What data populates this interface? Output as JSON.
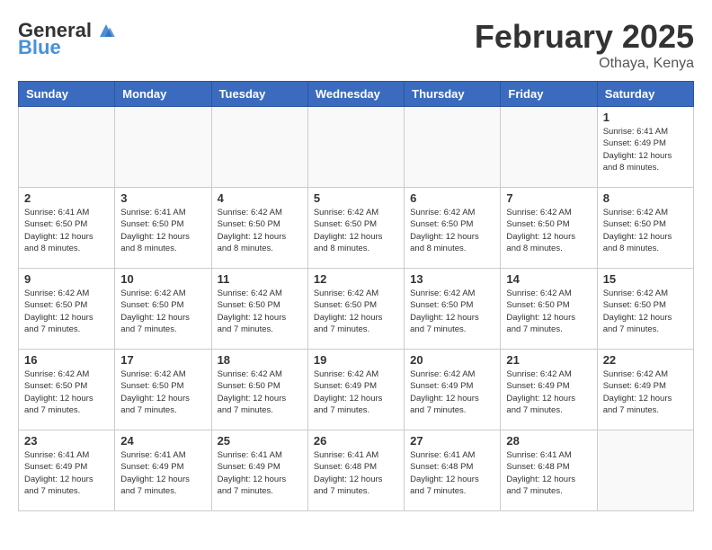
{
  "logo": {
    "general": "General",
    "blue": "Blue"
  },
  "header": {
    "month": "February 2025",
    "location": "Othaya, Kenya"
  },
  "weekdays": [
    "Sunday",
    "Monday",
    "Tuesday",
    "Wednesday",
    "Thursday",
    "Friday",
    "Saturday"
  ],
  "weeks": [
    [
      {
        "day": "",
        "info": ""
      },
      {
        "day": "",
        "info": ""
      },
      {
        "day": "",
        "info": ""
      },
      {
        "day": "",
        "info": ""
      },
      {
        "day": "",
        "info": ""
      },
      {
        "day": "",
        "info": ""
      },
      {
        "day": "1",
        "info": "Sunrise: 6:41 AM\nSunset: 6:49 PM\nDaylight: 12 hours\nand 8 minutes."
      }
    ],
    [
      {
        "day": "2",
        "info": "Sunrise: 6:41 AM\nSunset: 6:50 PM\nDaylight: 12 hours\nand 8 minutes."
      },
      {
        "day": "3",
        "info": "Sunrise: 6:41 AM\nSunset: 6:50 PM\nDaylight: 12 hours\nand 8 minutes."
      },
      {
        "day": "4",
        "info": "Sunrise: 6:42 AM\nSunset: 6:50 PM\nDaylight: 12 hours\nand 8 minutes."
      },
      {
        "day": "5",
        "info": "Sunrise: 6:42 AM\nSunset: 6:50 PM\nDaylight: 12 hours\nand 8 minutes."
      },
      {
        "day": "6",
        "info": "Sunrise: 6:42 AM\nSunset: 6:50 PM\nDaylight: 12 hours\nand 8 minutes."
      },
      {
        "day": "7",
        "info": "Sunrise: 6:42 AM\nSunset: 6:50 PM\nDaylight: 12 hours\nand 8 minutes."
      },
      {
        "day": "8",
        "info": "Sunrise: 6:42 AM\nSunset: 6:50 PM\nDaylight: 12 hours\nand 8 minutes."
      }
    ],
    [
      {
        "day": "9",
        "info": "Sunrise: 6:42 AM\nSunset: 6:50 PM\nDaylight: 12 hours\nand 7 minutes."
      },
      {
        "day": "10",
        "info": "Sunrise: 6:42 AM\nSunset: 6:50 PM\nDaylight: 12 hours\nand 7 minutes."
      },
      {
        "day": "11",
        "info": "Sunrise: 6:42 AM\nSunset: 6:50 PM\nDaylight: 12 hours\nand 7 minutes."
      },
      {
        "day": "12",
        "info": "Sunrise: 6:42 AM\nSunset: 6:50 PM\nDaylight: 12 hours\nand 7 minutes."
      },
      {
        "day": "13",
        "info": "Sunrise: 6:42 AM\nSunset: 6:50 PM\nDaylight: 12 hours\nand 7 minutes."
      },
      {
        "day": "14",
        "info": "Sunrise: 6:42 AM\nSunset: 6:50 PM\nDaylight: 12 hours\nand 7 minutes."
      },
      {
        "day": "15",
        "info": "Sunrise: 6:42 AM\nSunset: 6:50 PM\nDaylight: 12 hours\nand 7 minutes."
      }
    ],
    [
      {
        "day": "16",
        "info": "Sunrise: 6:42 AM\nSunset: 6:50 PM\nDaylight: 12 hours\nand 7 minutes."
      },
      {
        "day": "17",
        "info": "Sunrise: 6:42 AM\nSunset: 6:50 PM\nDaylight: 12 hours\nand 7 minutes."
      },
      {
        "day": "18",
        "info": "Sunrise: 6:42 AM\nSunset: 6:50 PM\nDaylight: 12 hours\nand 7 minutes."
      },
      {
        "day": "19",
        "info": "Sunrise: 6:42 AM\nSunset: 6:49 PM\nDaylight: 12 hours\nand 7 minutes."
      },
      {
        "day": "20",
        "info": "Sunrise: 6:42 AM\nSunset: 6:49 PM\nDaylight: 12 hours\nand 7 minutes."
      },
      {
        "day": "21",
        "info": "Sunrise: 6:42 AM\nSunset: 6:49 PM\nDaylight: 12 hours\nand 7 minutes."
      },
      {
        "day": "22",
        "info": "Sunrise: 6:42 AM\nSunset: 6:49 PM\nDaylight: 12 hours\nand 7 minutes."
      }
    ],
    [
      {
        "day": "23",
        "info": "Sunrise: 6:41 AM\nSunset: 6:49 PM\nDaylight: 12 hours\nand 7 minutes."
      },
      {
        "day": "24",
        "info": "Sunrise: 6:41 AM\nSunset: 6:49 PM\nDaylight: 12 hours\nand 7 minutes."
      },
      {
        "day": "25",
        "info": "Sunrise: 6:41 AM\nSunset: 6:49 PM\nDaylight: 12 hours\nand 7 minutes."
      },
      {
        "day": "26",
        "info": "Sunrise: 6:41 AM\nSunset: 6:48 PM\nDaylight: 12 hours\nand 7 minutes."
      },
      {
        "day": "27",
        "info": "Sunrise: 6:41 AM\nSunset: 6:48 PM\nDaylight: 12 hours\nand 7 minutes."
      },
      {
        "day": "28",
        "info": "Sunrise: 6:41 AM\nSunset: 6:48 PM\nDaylight: 12 hours\nand 7 minutes."
      },
      {
        "day": "",
        "info": ""
      }
    ]
  ]
}
